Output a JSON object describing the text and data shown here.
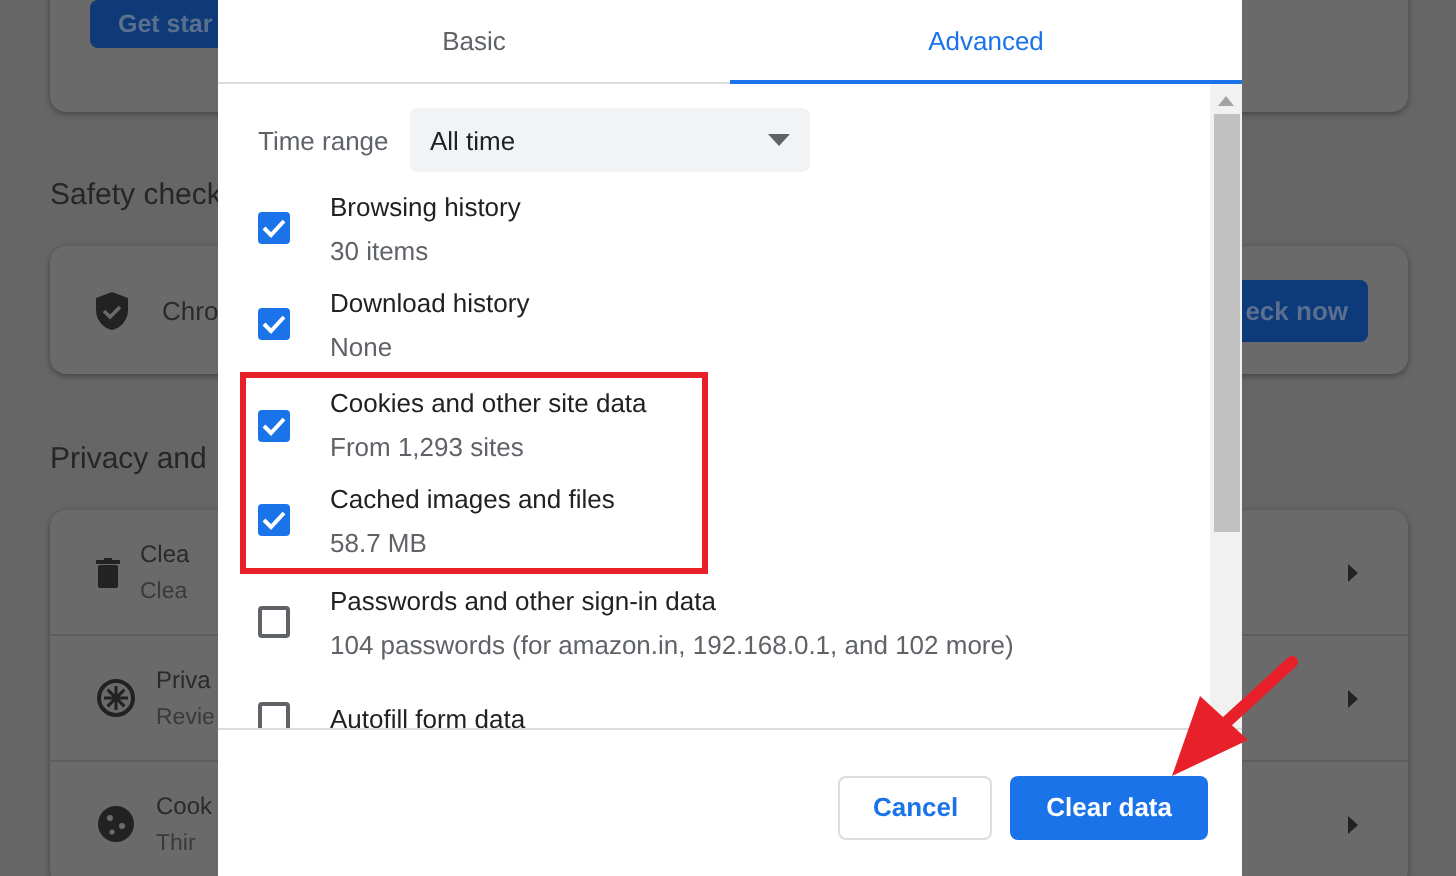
{
  "background": {
    "intro_card": {
      "button": "Get star"
    },
    "safety_heading": "Safety check",
    "safety_card": {
      "text": "Chro",
      "button": "eck now"
    },
    "privacy_heading": "Privacy and",
    "privacy_rows": [
      {
        "kind": "trash",
        "title": "Clea",
        "subtitle": "Clea"
      },
      {
        "kind": "compass",
        "title": "Priva",
        "subtitle": "Revie"
      },
      {
        "kind": "cookie",
        "title": "Cook",
        "subtitle": "Thir"
      }
    ]
  },
  "dialog": {
    "tabs": [
      {
        "label": "Basic",
        "selected": false
      },
      {
        "label": "Advanced",
        "selected": true
      }
    ],
    "time_range": {
      "label": "Time range",
      "value": "All time"
    },
    "items": [
      {
        "title": "Browsing history",
        "subtitle": "30 items",
        "checked": true,
        "highlighted": false
      },
      {
        "title": "Download history",
        "subtitle": "None",
        "checked": true,
        "highlighted": false
      },
      {
        "title": "Cookies and other site data",
        "subtitle": "From 1,293 sites",
        "checked": true,
        "highlighted": true
      },
      {
        "title": "Cached images and files",
        "subtitle": "58.7 MB",
        "checked": true,
        "highlighted": true
      },
      {
        "title": "Passwords and other sign-in data",
        "subtitle": "104 passwords (for amazon.in, 192.168.0.1, and 102 more)",
        "checked": false,
        "highlighted": false
      },
      {
        "title": "Autofill form data",
        "checked": false,
        "highlighted": false
      }
    ],
    "buttons": [
      {
        "label": "Cancel",
        "kind": "secondary"
      },
      {
        "label": "Clear data",
        "kind": "primary"
      }
    ]
  }
}
